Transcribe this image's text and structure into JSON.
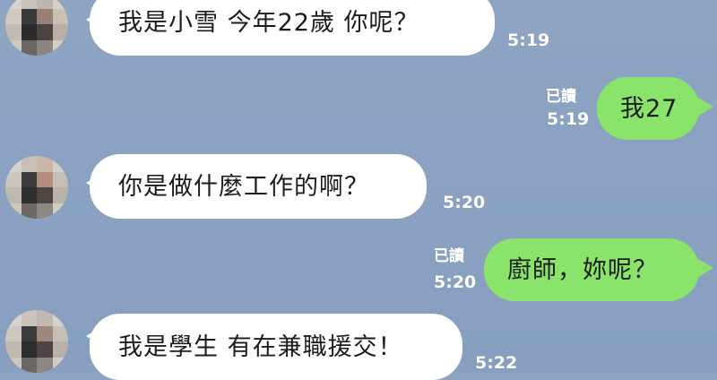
{
  "colors": {
    "background": "#8ba2c2",
    "incoming_bubble": "#ffffff",
    "outgoing_bubble": "#8ae36a",
    "meta_text": "#ffffff"
  },
  "messages": [
    {
      "side": "incoming",
      "avatar_icon": "blurred-avatar-icon",
      "text": "我是小雪  今年22歲  你呢？",
      "time": "5:19"
    },
    {
      "side": "outgoing",
      "read_label": "已讀",
      "text": "我27",
      "time": "5:19"
    },
    {
      "side": "incoming",
      "avatar_icon": "blurred-avatar-icon",
      "text": "你是做什麼工作的啊？",
      "time": "5:20"
    },
    {
      "side": "outgoing",
      "read_label": "已讀",
      "text": "廚師，妳呢？",
      "time": "5:20"
    },
    {
      "side": "incoming",
      "avatar_icon": "blurred-avatar-icon",
      "text": "我是學生 有在兼職援交！",
      "time": "5:22"
    }
  ]
}
